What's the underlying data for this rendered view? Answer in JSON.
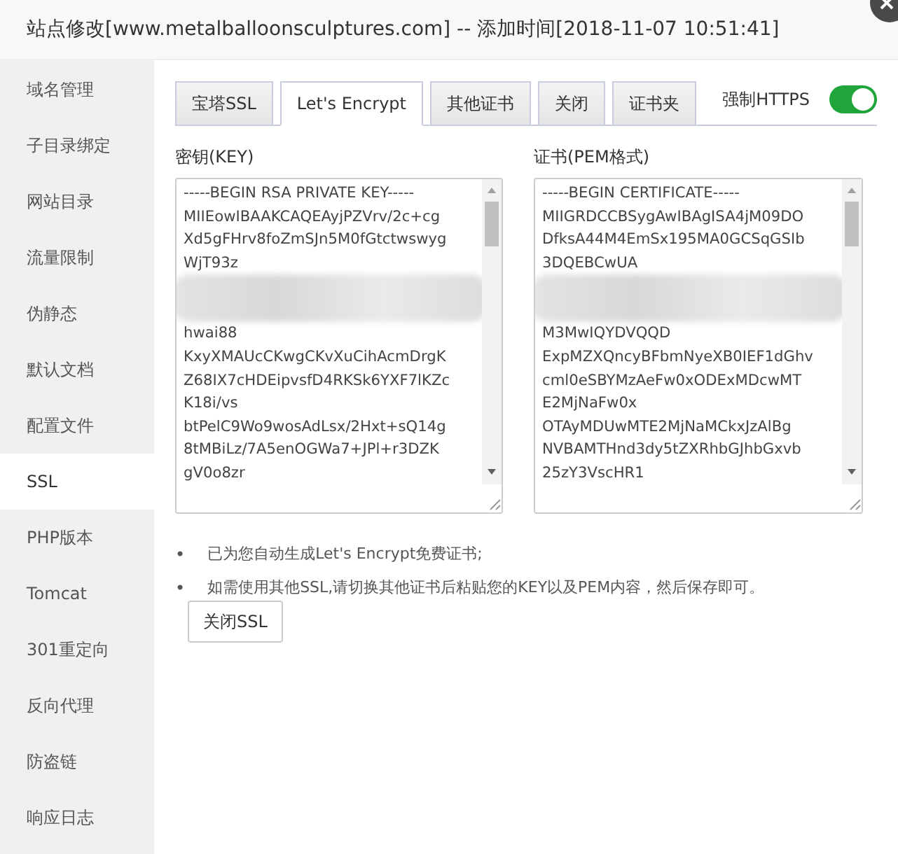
{
  "window": {
    "title": "站点修改[www.metalballoonsculptures.com] -- 添加时间[2018-11-07 10:51:41]"
  },
  "sidebar": {
    "items": [
      {
        "label": "域名管理",
        "selected": false
      },
      {
        "label": "子目录绑定",
        "selected": false
      },
      {
        "label": "网站目录",
        "selected": false
      },
      {
        "label": "流量限制",
        "selected": false
      },
      {
        "label": "伪静态",
        "selected": false
      },
      {
        "label": "默认文档",
        "selected": false
      },
      {
        "label": "配置文件",
        "selected": false
      },
      {
        "label": "SSL",
        "selected": true
      },
      {
        "label": "PHP版本",
        "selected": false
      },
      {
        "label": "Tomcat",
        "selected": false
      },
      {
        "label": "301重定向",
        "selected": false
      },
      {
        "label": "反向代理",
        "selected": false
      },
      {
        "label": "防盗链",
        "selected": false
      },
      {
        "label": "响应日志",
        "selected": false
      }
    ]
  },
  "tabs": [
    {
      "label": "宝塔SSL",
      "selected": false
    },
    {
      "label": "Let's Encrypt",
      "selected": true
    },
    {
      "label": "其他证书",
      "selected": false
    },
    {
      "label": "关闭",
      "selected": false
    },
    {
      "label": "证书夹",
      "selected": false
    }
  ],
  "force_https": {
    "label": "强制HTTPS",
    "on": true
  },
  "fields": [
    {
      "label": "密钥(KEY)",
      "lines": [
        {
          "kind": "text",
          "text": "-----BEGIN RSA PRIVATE KEY-----"
        },
        {
          "kind": "text",
          "text": "MIIEowIBAAKCAQEAyjPZVrv/2c+cg"
        },
        {
          "kind": "text",
          "text": "Xd5gFHrv8foZmSJn5M0fGtctwswyg"
        },
        {
          "kind": "text",
          "text": "WjT93z"
        },
        {
          "kind": "blurred"
        },
        {
          "kind": "text",
          "text": "hwai88"
        },
        {
          "kind": "text",
          "text": "KxyXMAUcCKwgCKvXuCihAcmDrgK"
        },
        {
          "kind": "text",
          "text": "Z68IX7cHDEipvsfD4RKSk6YXF7lKZc"
        },
        {
          "kind": "text",
          "text": "K18i/vs"
        },
        {
          "kind": "text",
          "text": "btPelC9Wo9wosAdLsx/2Hxt+sQ14g"
        },
        {
          "kind": "text",
          "text": "8tMBiLz/7A5enOGWa7+JPl+r3DZK"
        },
        {
          "kind": "text",
          "text": "gV0o8zr"
        }
      ]
    },
    {
      "label": "证书(PEM格式)",
      "lines": [
        {
          "kind": "text",
          "text": "-----BEGIN CERTIFICATE-----"
        },
        {
          "kind": "text",
          "text": "MIIGRDCCBSygAwIBAgISA4jM09DO"
        },
        {
          "kind": "text",
          "text": "DfksA44M4EmSx195MA0GCSqGSIb"
        },
        {
          "kind": "text",
          "text": "3DQEBCwUA"
        },
        {
          "kind": "blurred"
        },
        {
          "kind": "text",
          "text": "M3MwIQYDVQQD"
        },
        {
          "kind": "text",
          "text": "ExpMZXQncyBFbmNyeXB0IEF1dGhv"
        },
        {
          "kind": "text",
          "text": "cml0eSBYMzAeFw0xODExMDcwMT"
        },
        {
          "kind": "text",
          "text": "E2MjNaFw0x"
        },
        {
          "kind": "text",
          "text": "OTAyMDUwMTE2MjNaMCkxJzAlBg"
        },
        {
          "kind": "text",
          "text": "NVBAMTHnd3dy5tZXRhbGJhbGxvb"
        },
        {
          "kind": "text",
          "text": "25zY3VscHR1"
        }
      ]
    }
  ],
  "notes": [
    {
      "marker": "•",
      "text": "已为您自动生成Let's Encrypt免费证书;"
    },
    {
      "marker": "•",
      "text": "如需使用其他SSL,请切换其他证书后粘贴您的KEY以及PEM内容，然后保存即可。"
    }
  ],
  "buttons": [
    "关闭SSL"
  ]
}
